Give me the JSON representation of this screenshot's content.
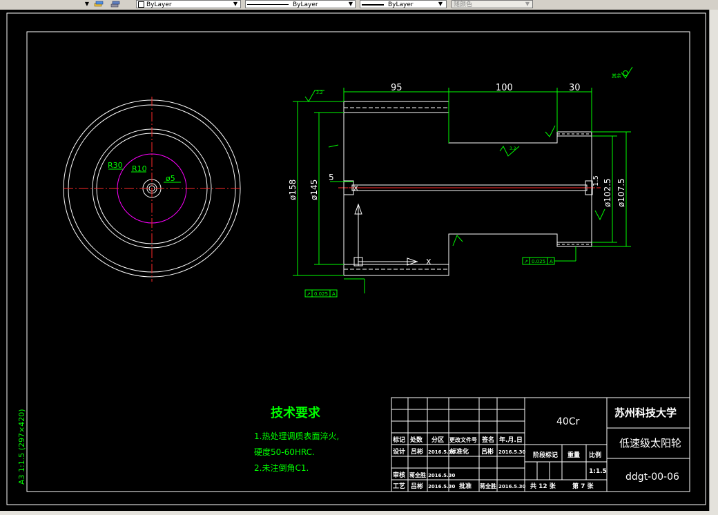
{
  "toolbar": {
    "layer_color": "ByLayer",
    "linetype": "ByLayer",
    "lineweight": "ByLayer",
    "plot_style": "随颜色"
  },
  "dimensions": {
    "len_95": "95",
    "len_100": "100",
    "len_30": "30",
    "dia_158": "ø158",
    "dia_145": "ø145",
    "dia_102": "ø102.5",
    "dia_107": "ø107.5",
    "r30": "R30",
    "r10": "R10",
    "dia_5": "ø5",
    "len_5": "5",
    "len_1_5": "1.5",
    "tol_left": "0.025",
    "tol_right": "0.025",
    "tol_ref": "A",
    "rough_small": "3.2",
    "rough_other": "其余"
  },
  "tech": {
    "title": "技术要求",
    "line1": "1.热处理调质表面淬火,",
    "line2": "硬度50-60HRC.",
    "line3": "2.未注倒角C1."
  },
  "side_label": "A3 1:1.5 (297×420)",
  "title_block": {
    "material": "40Cr",
    "school": "苏州科技大学",
    "part_name": "低速级太阳轮",
    "drawing_no": "ddgt-00-06",
    "h_mark": "标记",
    "h_count": "处数",
    "h_zone": "分区",
    "h_doc": "更改文件号",
    "h_sign": "签名",
    "h_date": "年.月.日",
    "r_design": "设计",
    "design_name": "吕彬",
    "design_date": "2016.5.16",
    "std": "标准化",
    "std_name": "吕彬",
    "std_date": "2016.5.30",
    "stage_mark": "阶段标记",
    "weight": "重量",
    "scale_h": "比例",
    "scale_v": "1:1.5",
    "r_check": "审核",
    "check_name": "蒋全胜",
    "check_date": "2016.5.30",
    "r_process": "工艺",
    "process_name": "吕彬",
    "process_date": "2016.5.30",
    "approve": "批准",
    "approve_name": "蒋全胜",
    "approve_date": "2016.5.30",
    "total_sheets": "共 12 张",
    "sheet_no": "第 7 张"
  }
}
